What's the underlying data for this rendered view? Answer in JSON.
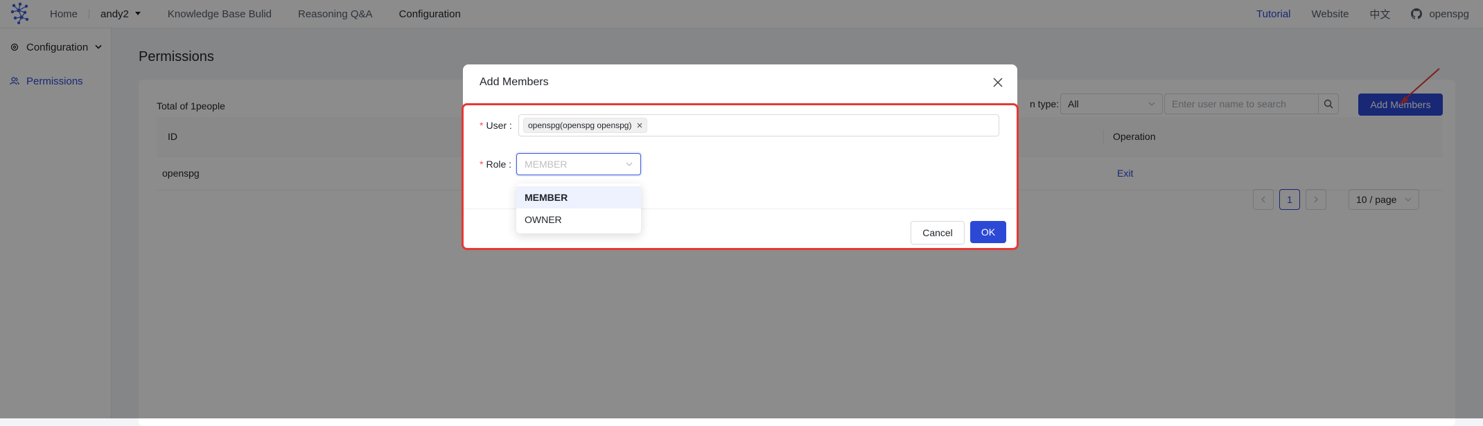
{
  "nav": {
    "home": "Home",
    "project": "andy2",
    "kb_build": "Knowledge Base Bulid",
    "reasoning": "Reasoning Q&A",
    "configuration": "Configuration"
  },
  "topright": {
    "tutorial": "Tutorial",
    "website": "Website",
    "lang": "中文",
    "username": "openspg"
  },
  "sidebar": {
    "section": "Configuration",
    "items": [
      {
        "label": "Permissions"
      }
    ]
  },
  "page": {
    "title": "Permissions",
    "total": "Total of 1people",
    "filter_label": "n type:",
    "filter_value": "All",
    "search_placeholder": "Enter user name to search",
    "add_button": "Add Members"
  },
  "table": {
    "headers": [
      "ID",
      "Operation"
    ],
    "rows": [
      {
        "id": "openspg",
        "action": "Exit"
      }
    ]
  },
  "pagination": {
    "current": "1",
    "page_size": "10 / page"
  },
  "modal": {
    "title": "Add Members",
    "user_label": "User",
    "user_tag": "openspg(openspg openspg)",
    "role_label": "Role",
    "role_placeholder": "MEMBER",
    "role_options": [
      "MEMBER",
      "OWNER"
    ],
    "cancel": "Cancel",
    "ok": "OK"
  },
  "colors": {
    "primary": "#2c49d6",
    "highlight": "#e53935"
  }
}
